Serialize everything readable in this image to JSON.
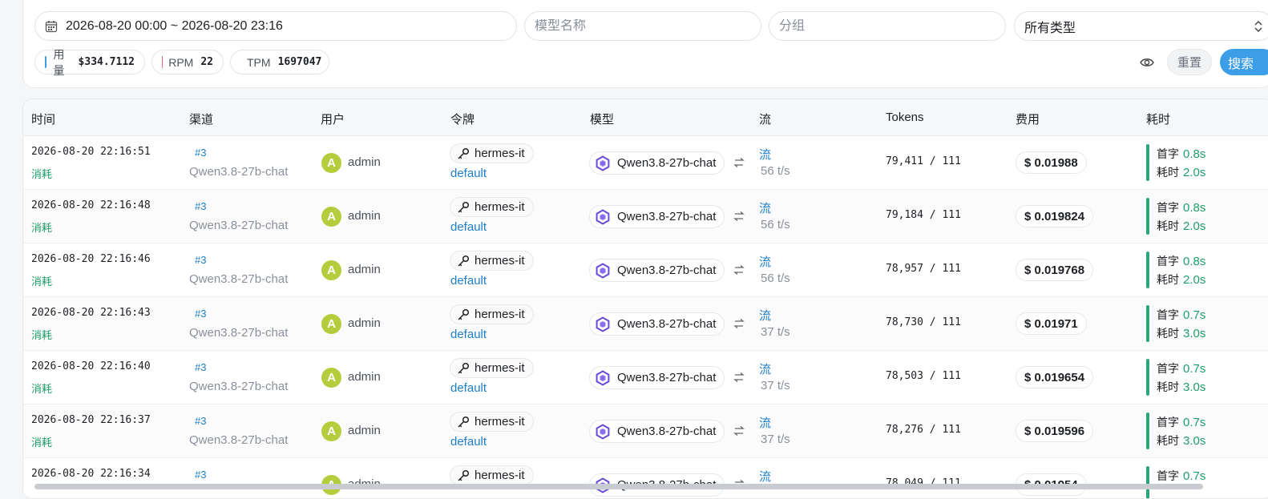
{
  "filters": {
    "date_range": "2026-08-20 00:00 ~ 2026-08-20 23:16",
    "model_placeholder": "模型名称",
    "group_placeholder": "分组",
    "type_selected": "所有类型"
  },
  "stats": {
    "usage_label": "用量",
    "usage_value": "$334.7112",
    "rpm_label": "RPM",
    "rpm_value": "22",
    "tpm_label": "TPM",
    "tpm_value": "1697047",
    "usage_color": "#3d9ee8",
    "rpm_color": "#e8657a",
    "tpm_color": "#c9ccd1"
  },
  "actions": {
    "reset_label": "重置",
    "search_label": "搜索"
  },
  "table": {
    "columns": [
      "时间",
      "渠道",
      "用户",
      "令牌",
      "模型",
      "流",
      "Tokens",
      "费用",
      "耗时"
    ],
    "first_token_label": "首字",
    "duration_label": "耗时",
    "rows": [
      {
        "time": "2026-08-20 22:16:51",
        "kind": "消耗",
        "channel_id": "#3",
        "channel_name": "Qwen3.8-27b-chat",
        "avatar": "A",
        "user": "admin",
        "token": "hermes-it",
        "group": "default",
        "model": "Qwen3.8-27b-chat",
        "stream": "流",
        "speed": "56 t/s",
        "tokens": "79,411 / 111",
        "cost": "$ 0.01988",
        "first": "0.8s",
        "total": "2.0s"
      },
      {
        "time": "2026-08-20 22:16:48",
        "kind": "消耗",
        "channel_id": "#3",
        "channel_name": "Qwen3.8-27b-chat",
        "avatar": "A",
        "user": "admin",
        "token": "hermes-it",
        "group": "default",
        "model": "Qwen3.8-27b-chat",
        "stream": "流",
        "speed": "56 t/s",
        "tokens": "79,184 / 111",
        "cost": "$ 0.019824",
        "first": "0.8s",
        "total": "2.0s"
      },
      {
        "time": "2026-08-20 22:16:46",
        "kind": "消耗",
        "channel_id": "#3",
        "channel_name": "Qwen3.8-27b-chat",
        "avatar": "A",
        "user": "admin",
        "token": "hermes-it",
        "group": "default",
        "model": "Qwen3.8-27b-chat",
        "stream": "流",
        "speed": "56 t/s",
        "tokens": "78,957 / 111",
        "cost": "$ 0.019768",
        "first": "0.8s",
        "total": "2.0s"
      },
      {
        "time": "2026-08-20 22:16:43",
        "kind": "消耗",
        "channel_id": "#3",
        "channel_name": "Qwen3.8-27b-chat",
        "avatar": "A",
        "user": "admin",
        "token": "hermes-it",
        "group": "default",
        "model": "Qwen3.8-27b-chat",
        "stream": "流",
        "speed": "37 t/s",
        "tokens": "78,730 / 111",
        "cost": "$ 0.01971",
        "first": "0.7s",
        "total": "3.0s"
      },
      {
        "time": "2026-08-20 22:16:40",
        "kind": "消耗",
        "channel_id": "#3",
        "channel_name": "Qwen3.8-27b-chat",
        "avatar": "A",
        "user": "admin",
        "token": "hermes-it",
        "group": "default",
        "model": "Qwen3.8-27b-chat",
        "stream": "流",
        "speed": "37 t/s",
        "tokens": "78,503 / 111",
        "cost": "$ 0.019654",
        "first": "0.7s",
        "total": "3.0s"
      },
      {
        "time": "2026-08-20 22:16:37",
        "kind": "消耗",
        "channel_id": "#3",
        "channel_name": "Qwen3.8-27b-chat",
        "avatar": "A",
        "user": "admin",
        "token": "hermes-it",
        "group": "default",
        "model": "Qwen3.8-27b-chat",
        "stream": "流",
        "speed": "37 t/s",
        "tokens": "78,276 / 111",
        "cost": "$ 0.019596",
        "first": "0.7s",
        "total": "3.0s"
      },
      {
        "time": "2026-08-20 22:16:34",
        "kind": "",
        "channel_id": "#3",
        "channel_name": "",
        "avatar": "A",
        "user": "admin",
        "token": "hermes-it",
        "group": "",
        "model": "Qwen3.8-27b-chat",
        "stream": "流",
        "speed": "",
        "tokens": "78,049 / 111",
        "cost": "$ 0.01954",
        "first": "0.7s",
        "total": ""
      }
    ]
  }
}
